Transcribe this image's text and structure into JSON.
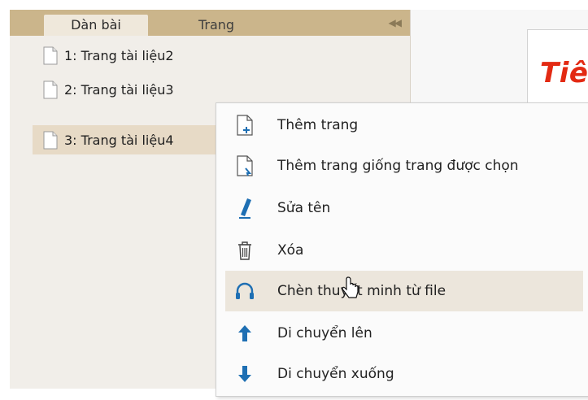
{
  "tabs": {
    "outline": "Dàn bài",
    "pages": "Trang",
    "collapse_glyph": "◀◀"
  },
  "pages": [
    {
      "label": "1: Trang tài liệu2",
      "selected": false
    },
    {
      "label": "2: Trang tài liệu3",
      "selected": false
    },
    {
      "label": "3: Trang tài liệu4",
      "selected": true
    }
  ],
  "slide": {
    "title_fragment": "Tiê",
    "title_color": "#e32a13"
  },
  "context_menu": {
    "items": [
      {
        "label": "Thêm trang",
        "icon": "add-page-icon"
      },
      {
        "label": "Thêm trang giống trang được chọn",
        "icon": "duplicate-page-icon"
      },
      {
        "label": "Sửa tên",
        "icon": "pencil-icon"
      },
      {
        "label": "Xóa",
        "icon": "trash-icon"
      },
      {
        "label": "Chèn thuyết minh từ file",
        "icon": "headphones-icon",
        "highlighted": true
      },
      {
        "label": "Di chuyển lên",
        "icon": "arrow-up-icon"
      },
      {
        "label": "Di chuyển xuống",
        "icon": "arrow-down-icon"
      }
    ]
  },
  "colors": {
    "tab_bar": "#cbb58b",
    "panel_bg": "#f1eee9",
    "selected_row": "#e7dac6",
    "icon_blue": "#1e6fb3"
  }
}
